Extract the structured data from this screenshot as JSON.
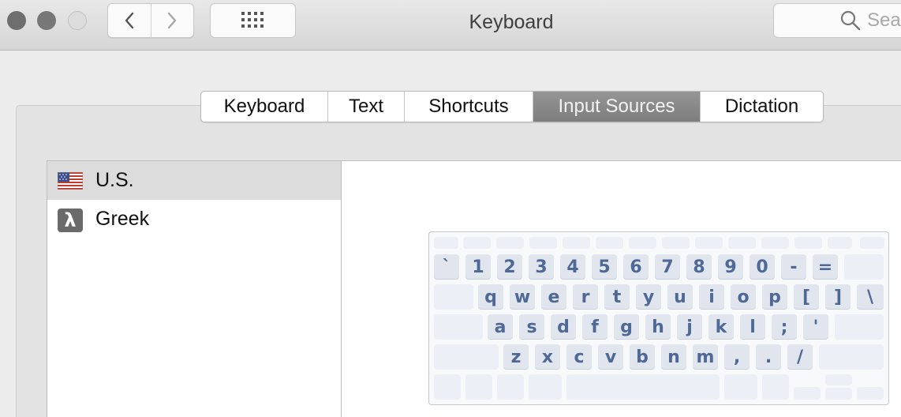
{
  "window": {
    "title": "Keyboard",
    "search_placeholder": "Search"
  },
  "icons": {
    "back": "chevron-left-icon",
    "forward": "chevron-right-icon",
    "show_all": "grid-icon",
    "search": "search-icon"
  },
  "tabs": [
    {
      "label": "Keyboard",
      "selected": false
    },
    {
      "label": "Text",
      "selected": false
    },
    {
      "label": "Shortcuts",
      "selected": false
    },
    {
      "label": "Input Sources",
      "selected": true
    },
    {
      "label": "Dictation",
      "selected": false
    }
  ],
  "input_sources": [
    {
      "label": "U.S.",
      "icon": "us-flag-icon",
      "selected": true
    },
    {
      "label": "Greek",
      "icon": "lambda-icon",
      "selected": false,
      "icon_glyph": "λ"
    }
  ],
  "keyboard": {
    "row_number": [
      "`",
      "1",
      "2",
      "3",
      "4",
      "5",
      "6",
      "7",
      "8",
      "9",
      "0",
      "-",
      "="
    ],
    "row_top": [
      "q",
      "w",
      "e",
      "r",
      "t",
      "y",
      "u",
      "i",
      "o",
      "p",
      "[",
      "]",
      "\\"
    ],
    "row_home": [
      "a",
      "s",
      "d",
      "f",
      "g",
      "h",
      "j",
      "k",
      "l",
      ";",
      "'"
    ],
    "row_bottom": [
      "z",
      "x",
      "c",
      "v",
      "b",
      "n",
      "m",
      ",",
      ".",
      "/"
    ]
  },
  "colors": {
    "key_label": "#4e6996",
    "selected_tab": "#858585"
  }
}
